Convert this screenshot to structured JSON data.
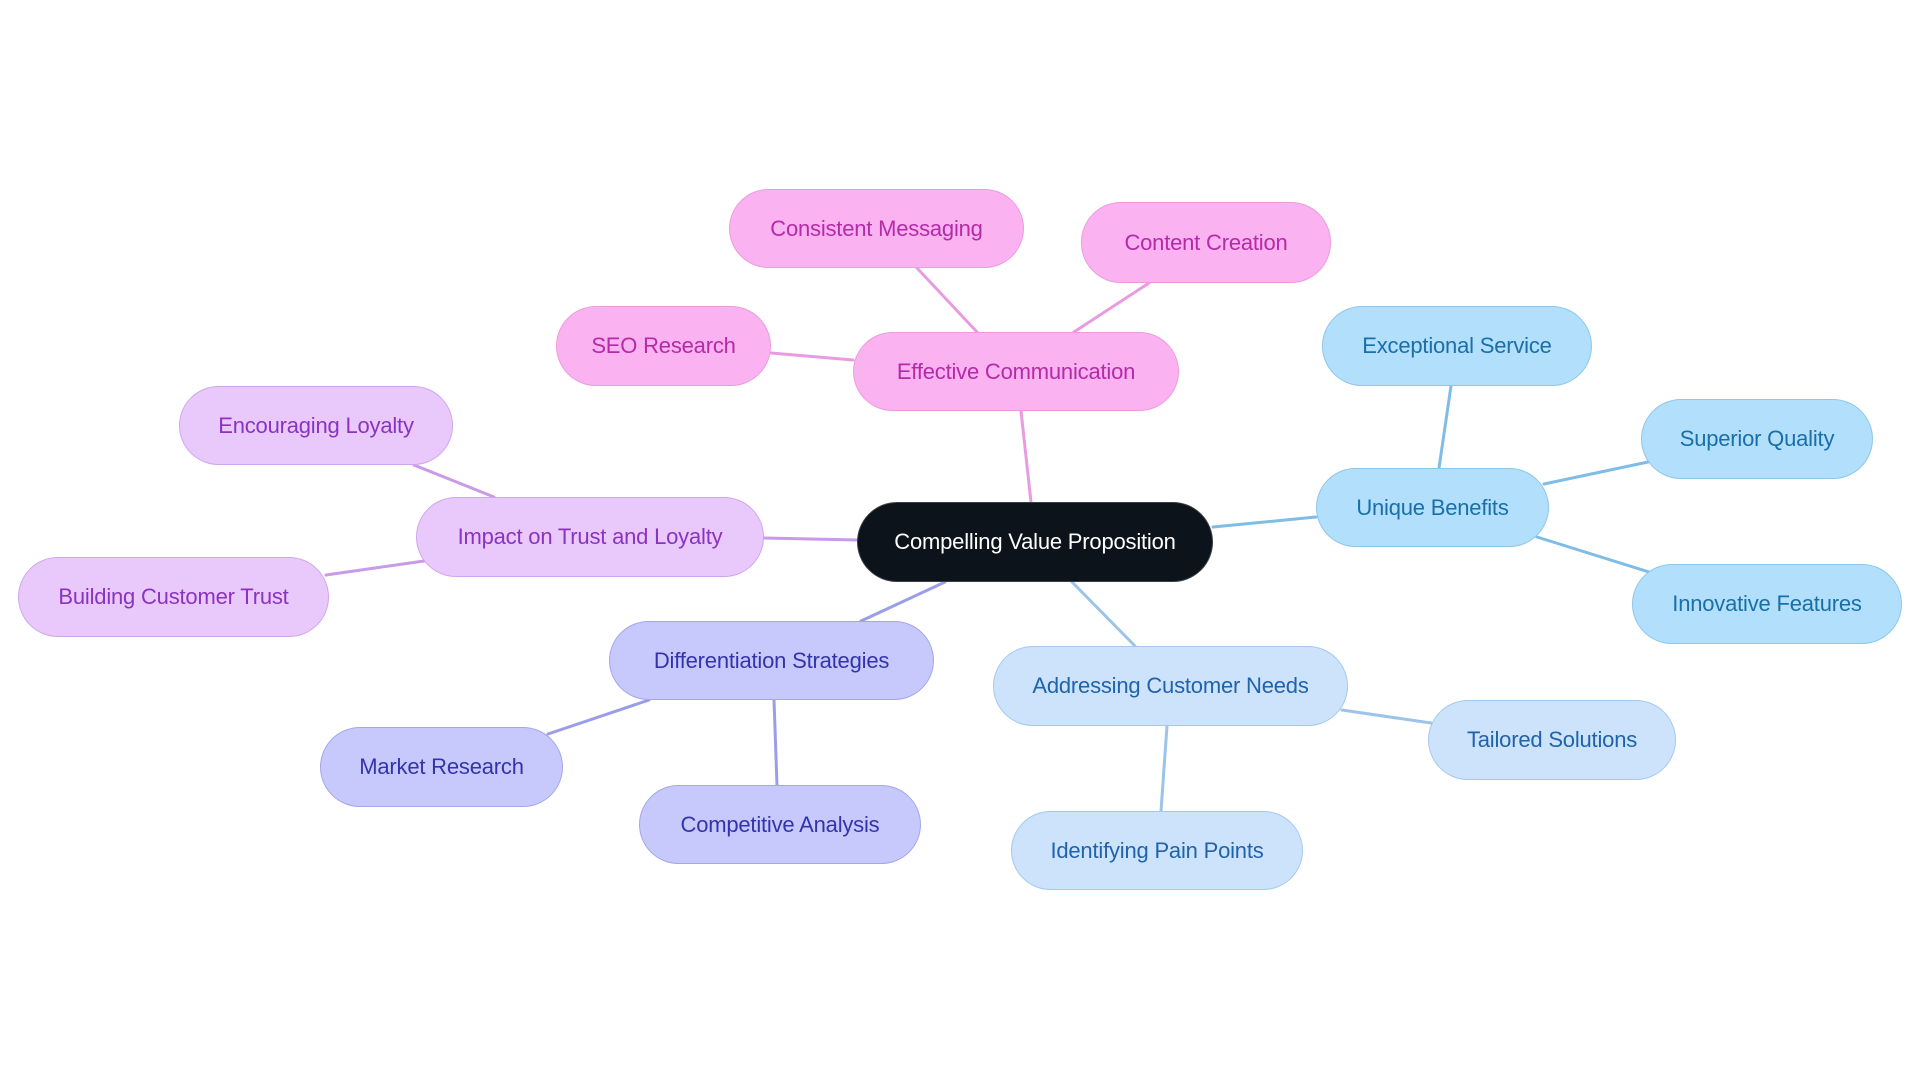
{
  "diagram": {
    "type": "mindmap",
    "root": {
      "id": "root",
      "label": "Compelling Value Proposition"
    },
    "colors": {
      "root_bg": "#0d131a",
      "root_text": "#ffffff",
      "pink": {
        "fill": "#fbb2f1",
        "stroke": "#ec9be0",
        "text": "#b52aa8",
        "edge": "#e89be0"
      },
      "blue": {
        "fill": "#b2dffc",
        "stroke": "#8ec6ea",
        "text": "#1a6fa8",
        "edge": "#7fbde6"
      },
      "lblue": {
        "fill": "#cce3fb",
        "stroke": "#a4c9ec",
        "text": "#1f63ad",
        "edge": "#9cc3ea"
      },
      "indigo": {
        "fill": "#c7c9fc",
        "stroke": "#a3a6ec",
        "text": "#3334ad",
        "edge": "#9a9ee8"
      },
      "violet": {
        "fill": "#e9c9fc",
        "stroke": "#cfa6ee",
        "text": "#8a33c0",
        "edge": "#c99ae8"
      }
    },
    "branches": [
      {
        "id": "effective-communication",
        "label": "Effective Communication",
        "theme": "pink",
        "children": [
          {
            "id": "consistent-messaging",
            "label": "Consistent Messaging"
          },
          {
            "id": "content-creation",
            "label": "Content Creation"
          },
          {
            "id": "seo-research",
            "label": "SEO Research"
          }
        ]
      },
      {
        "id": "unique-benefits",
        "label": "Unique Benefits",
        "theme": "blue",
        "children": [
          {
            "id": "exceptional-service",
            "label": "Exceptional Service"
          },
          {
            "id": "superior-quality",
            "label": "Superior Quality"
          },
          {
            "id": "innovative-features",
            "label": "Innovative Features"
          }
        ]
      },
      {
        "id": "addressing-customer-needs",
        "label": "Addressing Customer Needs",
        "theme": "lblue",
        "children": [
          {
            "id": "tailored-solutions",
            "label": "Tailored Solutions"
          },
          {
            "id": "identifying-pain-points",
            "label": "Identifying Pain Points"
          }
        ]
      },
      {
        "id": "differentiation-strategies",
        "label": "Differentiation Strategies",
        "theme": "indigo",
        "children": [
          {
            "id": "market-research",
            "label": "Market Research"
          },
          {
            "id": "competitive-analysis",
            "label": "Competitive Analysis"
          }
        ]
      },
      {
        "id": "impact-on-trust-and-loyalty",
        "label": "Impact on Trust and Loyalty",
        "theme": "violet",
        "children": [
          {
            "id": "encouraging-loyalty",
            "label": "Encouraging Loyalty"
          },
          {
            "id": "building-customer-trust",
            "label": "Building Customer Trust"
          }
        ]
      }
    ]
  }
}
